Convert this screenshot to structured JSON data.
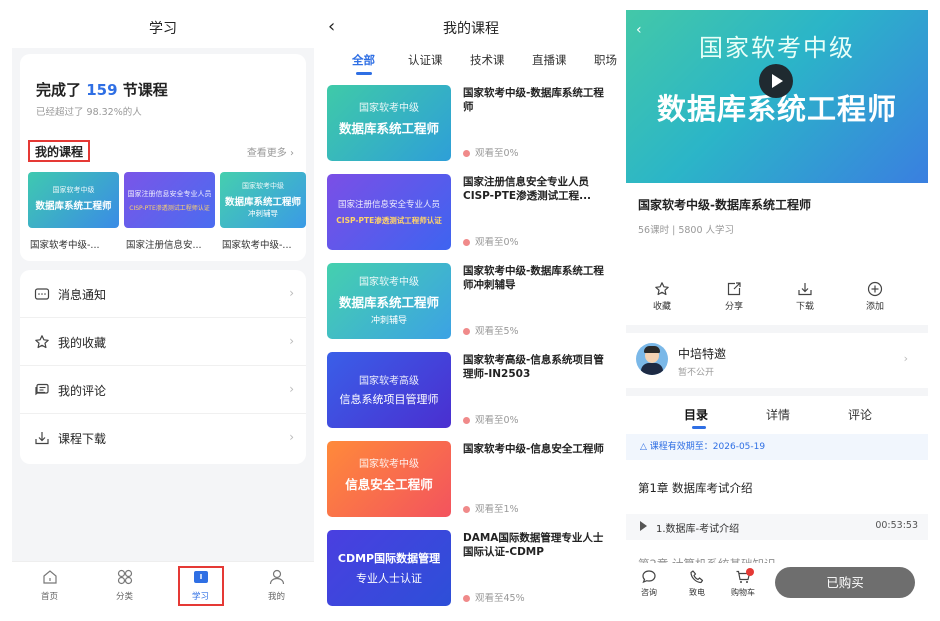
{
  "screen1": {
    "title": "学习",
    "completed_prefix": "完成了",
    "completed_count": "159",
    "completed_suffix": "节课程",
    "beyond_text": "已经超过了 98.32%的人",
    "my_courses_label": "我的课程",
    "see_more": "查看更多",
    "thumbnails": [
      {
        "line1": "国家软考中级",
        "line2": "数据库系统工程师",
        "line3": "",
        "caption": "国家软考中级-..."
      },
      {
        "line1": "国家注册信息安全专业人员",
        "line2": "",
        "line3": "CISP-PTE渗透测试工程师认证",
        "caption": "国家注册信息安..."
      },
      {
        "line1": "国家软考中级",
        "line2": "数据库系统工程师",
        "line3": "冲刺辅导",
        "caption": "国家软考中级-..."
      }
    ],
    "menu": [
      {
        "label": "消息通知",
        "icon": "message-icon"
      },
      {
        "label": "我的收藏",
        "icon": "star-icon"
      },
      {
        "label": "我的评论",
        "icon": "comment-icon"
      },
      {
        "label": "课程下载",
        "icon": "download-icon"
      }
    ],
    "tabs": [
      {
        "label": "首页",
        "icon": "home-icon"
      },
      {
        "label": "分类",
        "icon": "category-icon"
      },
      {
        "label": "学习",
        "icon": "study-icon",
        "active": true
      },
      {
        "label": "我的",
        "icon": "profile-icon"
      }
    ]
  },
  "screen2": {
    "title": "我的课程",
    "tabs": [
      "全部",
      "认证课",
      "技术课",
      "直播课",
      "职场"
    ],
    "courses": [
      {
        "thumb_line1": "国家软考中级",
        "thumb_line2": "数据库系统工程师",
        "thumb_line3": "",
        "title": "国家软考中级-数据库系统工程师",
        "progress": "观看至0%"
      },
      {
        "thumb_line1": "国家注册信息安全专业人员",
        "thumb_line2": "CISP-PTE渗透测试工程师认证",
        "thumb_line3": "",
        "title": "国家注册信息安全专业人员CISP-PTE渗透测试工程...",
        "progress": "观看至0%"
      },
      {
        "thumb_line1": "国家软考中级",
        "thumb_line2": "数据库系统工程师",
        "thumb_line3": "冲刺辅导",
        "title": "国家软考中级-数据库系统工程师冲刺辅导",
        "progress": "观看至5%"
      },
      {
        "thumb_line1": "国家软考高级",
        "thumb_line2": "信息系统项目管理师",
        "thumb_line3": "",
        "title": "国家软考高级-信息系统项目管理师-IN2503",
        "progress": "观看至0%"
      },
      {
        "thumb_line1": "国家软考中级",
        "thumb_line2": "信息安全工程师",
        "thumb_line3": "",
        "title": "国家软考中级-信息安全工程师",
        "progress": "观看至1%"
      },
      {
        "thumb_line1": "CDMP国际数据管理",
        "thumb_line2": "专业人士认证",
        "thumb_line3": "",
        "title": "DAMA国际数据管理专业人士国际认证-CDMP",
        "progress": "观看至45%"
      }
    ]
  },
  "screen3": {
    "banner_line1": "国家软考中级",
    "banner_line2": "数据库系统工程师",
    "course_name": "国家软考中级-数据库系统工程师",
    "meta": "56课时 | 5800 人学习",
    "actions": [
      {
        "label": "收藏",
        "icon": "star-icon"
      },
      {
        "label": "分享",
        "icon": "share-icon"
      },
      {
        "label": "下载",
        "icon": "download-icon"
      },
      {
        "label": "添加",
        "icon": "add-icon"
      }
    ],
    "teacher_name": "中培特邀",
    "teacher_sub": "暂不公开",
    "tabs": [
      "目录",
      "详情",
      "评论"
    ],
    "validity": "课程有效期至：2026-05-19",
    "chapter": "第1章 数据库考试介绍",
    "lesson": {
      "name": "1.数据库-考试介绍",
      "duration": "00:53:53"
    },
    "next_chapter_partial": "第2章 计算机系统基础知识",
    "bottom": [
      {
        "label": "咨询",
        "icon": "chat-icon"
      },
      {
        "label": "致电",
        "icon": "phone-icon"
      },
      {
        "label": "购物车",
        "icon": "cart-icon"
      }
    ],
    "bought_label": "已购买"
  },
  "colors": {
    "accent": "#2f6fe4",
    "highlight_border": "#e53935",
    "page_bg": "#f4f5f7"
  }
}
